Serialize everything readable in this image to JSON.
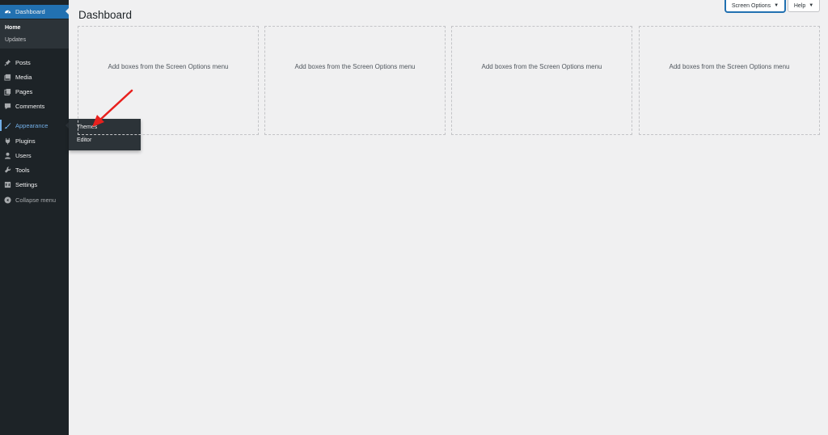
{
  "sidebar": {
    "dashboard": "Dashboard",
    "dashboard_sub": [
      "Home",
      "Updates"
    ],
    "items": [
      {
        "label": "Posts",
        "icon": "pushpin-icon"
      },
      {
        "label": "Media",
        "icon": "media-icon"
      },
      {
        "label": "Pages",
        "icon": "pages-icon"
      },
      {
        "label": "Comments",
        "icon": "comment-icon"
      },
      {
        "label": "Appearance",
        "icon": "paintbrush-icon"
      },
      {
        "label": "Plugins",
        "icon": "plugin-icon"
      },
      {
        "label": "Users",
        "icon": "user-icon"
      },
      {
        "label": "Tools",
        "icon": "wrench-icon"
      },
      {
        "label": "Settings",
        "icon": "settings-icon"
      }
    ],
    "collapse": "Collapse menu"
  },
  "flyout": {
    "items": [
      "Themes",
      "Editor"
    ]
  },
  "header": {
    "screen_options": "Screen Options",
    "help": "Help",
    "title": "Dashboard"
  },
  "boxes": [
    "Add boxes from the Screen Options menu",
    "Add boxes from the Screen Options menu",
    "Add boxes from the Screen Options menu",
    "Add boxes from the Screen Options menu"
  ],
  "colors": {
    "sidebar_bg": "#1d2327",
    "accent": "#2271b1",
    "highlight": "#72aee6",
    "annotation_arrow": "#e8201d"
  }
}
